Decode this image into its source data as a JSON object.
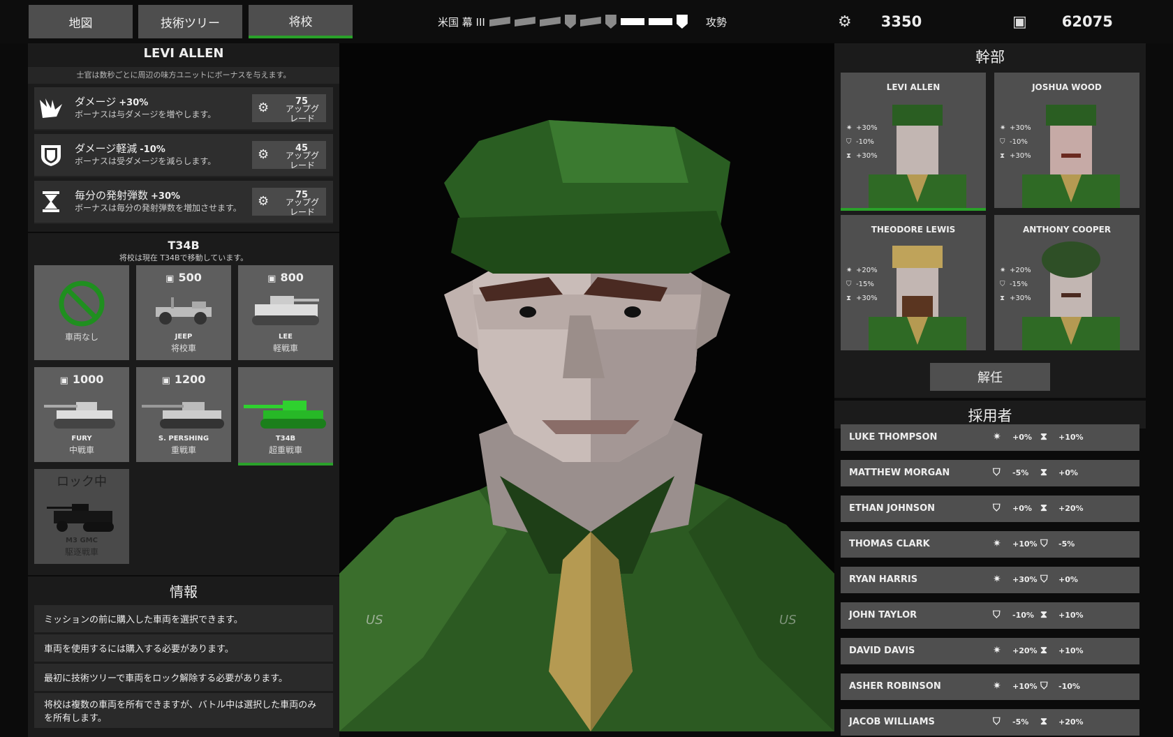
{
  "tabs": [
    {
      "label": "地図"
    },
    {
      "label": "技術ツリー"
    },
    {
      "label": "将校"
    }
  ],
  "campaign": {
    "label": "米国 幕 III",
    "mode": "攻勢"
  },
  "resources": {
    "parts": "3350",
    "money": "62075"
  },
  "officer": {
    "name": "LEVI ALLEN",
    "hint": "士官は数秒ごとに周辺の味方ユニットにボーナスを与えます。",
    "bonuses": [
      {
        "icon": "claw-icon",
        "title": "ダメージ",
        "value": "+30%",
        "desc": "ボーナスは与ダメージを増やします。",
        "cost": "75",
        "upgrade": "アップグレード"
      },
      {
        "icon": "shield-icon",
        "title": "ダメージ軽減",
        "value": "-10%",
        "desc": "ボーナスは受ダメージを減らします。",
        "cost": "45",
        "upgrade": "アップグレード"
      },
      {
        "icon": "hourglass-icon",
        "title": "毎分の発射弾数",
        "value": "+30%",
        "desc": "ボーナスは毎分の発射弾数を増加させます。",
        "cost": "75",
        "upgrade": "アップグレード"
      }
    ]
  },
  "vehicle_section": {
    "name": "T34B",
    "subtitle": "将校は現在 T34Bで移動しています。"
  },
  "vehicles": [
    {
      "price": "",
      "name": "",
      "class": "車両なし"
    },
    {
      "price": "500",
      "name": "JEEP",
      "class": "将校車"
    },
    {
      "price": "800",
      "name": "LEE",
      "class": "軽戦車"
    },
    {
      "price": "1000",
      "name": "FURY",
      "class": "中戦車"
    },
    {
      "price": "1200",
      "name": "S. PERSHING",
      "class": "重戦車"
    },
    {
      "price": "",
      "name": "T34B",
      "class": "超重戦車"
    },
    {
      "price": "",
      "name": "M3 GMC",
      "class": "駆逐戦車",
      "locked_label": "ロック中"
    }
  ],
  "info": {
    "title": "情報",
    "items": [
      "ミッションの前に購入した車両を選択できます。",
      "車両を使用するには購入する必要があります。",
      "最初に技術ツリーで車両をロック解除する必要があります。",
      "将校は複数の車両を所有できますが、バトル中は選択した車両のみを所有します。"
    ]
  },
  "staff": {
    "title": "幹部",
    "officers": [
      {
        "name": "LEVI ALLEN",
        "dmg": "+30%",
        "def": "-10%",
        "rof": "+30%"
      },
      {
        "name": "JOSHUA WOOD",
        "dmg": "+30%",
        "def": "-10%",
        "rof": "+30%"
      },
      {
        "name": "THEODORE LEWIS",
        "dmg": "+20%",
        "def": "-15%",
        "rof": "+30%"
      },
      {
        "name": "ANTHONY COOPER",
        "dmg": "+20%",
        "def": "-15%",
        "rof": "+30%"
      }
    ],
    "dismiss": "解任"
  },
  "recruits": {
    "title": "採用者",
    "rows": [
      {
        "name": "LUKE THOMPSON",
        "i1": "claw-icon",
        "v1": "+0%",
        "i2": "hourglass-icon",
        "v2": "+10%"
      },
      {
        "name": "MATTHEW MORGAN",
        "i1": "shield-icon",
        "v1": "-5%",
        "i2": "hourglass-icon",
        "v2": "+0%"
      },
      {
        "name": "ETHAN JOHNSON",
        "i1": "shield-icon",
        "v1": "+0%",
        "i2": "hourglass-icon",
        "v2": "+20%"
      },
      {
        "name": "THOMAS CLARK",
        "i1": "claw-icon",
        "v1": "+10%",
        "i2": "shield-icon",
        "v2": "-5%"
      },
      {
        "name": "RYAN HARRIS",
        "i1": "claw-icon",
        "v1": "+30%",
        "i2": "shield-icon",
        "v2": "+0%"
      },
      {
        "name": "JOHN TAYLOR",
        "i1": "shield-icon",
        "v1": "-10%",
        "i2": "hourglass-icon",
        "v2": "+10%"
      },
      {
        "name": "DAVID DAVIS",
        "i1": "claw-icon",
        "v1": "+20%",
        "i2": "hourglass-icon",
        "v2": "+10%"
      },
      {
        "name": "ASHER ROBINSON",
        "i1": "claw-icon",
        "v1": "+10%",
        "i2": "shield-icon",
        "v2": "-10%"
      },
      {
        "name": "JACOB WILLIAMS",
        "i1": "shield-icon",
        "v1": "-5%",
        "i2": "hourglass-icon",
        "v2": "+20%"
      }
    ]
  },
  "portrait": {
    "shoulder_left": "US",
    "shoulder_right": "US"
  },
  "colors": {
    "accent_green": "#2aa12a",
    "panel": "#1b1b1b",
    "card": "#4f4f4f"
  }
}
